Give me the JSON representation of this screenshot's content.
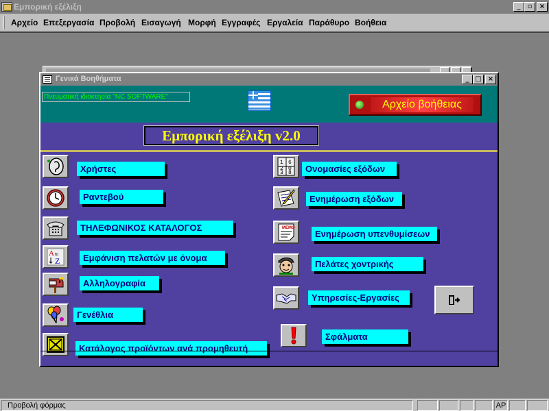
{
  "app": {
    "title": "Εμπορική εξέλιξη",
    "window_buttons": {
      "minimize": "_",
      "restore": "▫",
      "close": "×"
    }
  },
  "menubar": {
    "items": [
      "Αρχείο",
      "Επεξεργασία",
      "Προβολή",
      "Εισαγωγή",
      "Μορφή",
      "Εγγραφές",
      "Εργαλεία",
      "Παράθυρο",
      "Βοήθεια"
    ]
  },
  "form": {
    "title": "Γενικά Βοηθήματα",
    "window_buttons": {
      "minimize": "_",
      "maximize": "□",
      "close": "×"
    },
    "copyright": "Πνευματική ιδιοκτησία \"NC SOFTWARE\"",
    "help_button": "Αρχείο βοήθειας",
    "heading": "Εμπορική εξέλιξη  v2.0",
    "colors": {
      "body": "#5040a0",
      "header": "#007878",
      "label_bg": "#00ffff",
      "label_text": "#000080",
      "heading_text": "#ffff00"
    },
    "left_items": [
      {
        "label": "Χρήστες",
        "icon": "ear-icon"
      },
      {
        "label": "Ραντεβού",
        "icon": "clock-icon"
      },
      {
        "label": "ΤΗΛΕΦΩΝΙΚΟΣ ΚΑΤΑΛΟΓΟΣ",
        "icon": "telephone-icon"
      },
      {
        "label": "Εμφάνιση πελατών με όνομα",
        "icon": "sort-az-icon"
      },
      {
        "label": "Αλληλογραφία",
        "icon": "mailbox-icon"
      },
      {
        "label": "Γενέθλια",
        "icon": "balloons-icon"
      },
      {
        "label": "Κατάλογος προϊόντων ανά προμηθευτή",
        "icon": "crate-icon"
      }
    ],
    "right_items": [
      {
        "label": "Ονομασίες εξόδων",
        "icon": "calculator-icon",
        "digits": [
          "1",
          "2",
          "3",
          "6",
          "0",
          "8"
        ]
      },
      {
        "label": "Ενημέρωση εξόδων",
        "icon": "pencil-paper-icon"
      },
      {
        "label": "Ενημέρωση υπενθυμίσεων",
        "icon": "memo-icon",
        "memo_text": "MEMO"
      },
      {
        "label": "Πελάτες χοντρικής",
        "icon": "customer-face-icon"
      },
      {
        "label": "Υπηρεσίες-Εργασίες",
        "icon": "handshake-icon"
      },
      {
        "label": "Σφάλματα",
        "icon": "exclamation-icon"
      }
    ],
    "exit_icon": "exit-door-icon"
  },
  "statusbar": {
    "text": "Προβολή φόρμας",
    "indicator": "ΑΡ"
  }
}
